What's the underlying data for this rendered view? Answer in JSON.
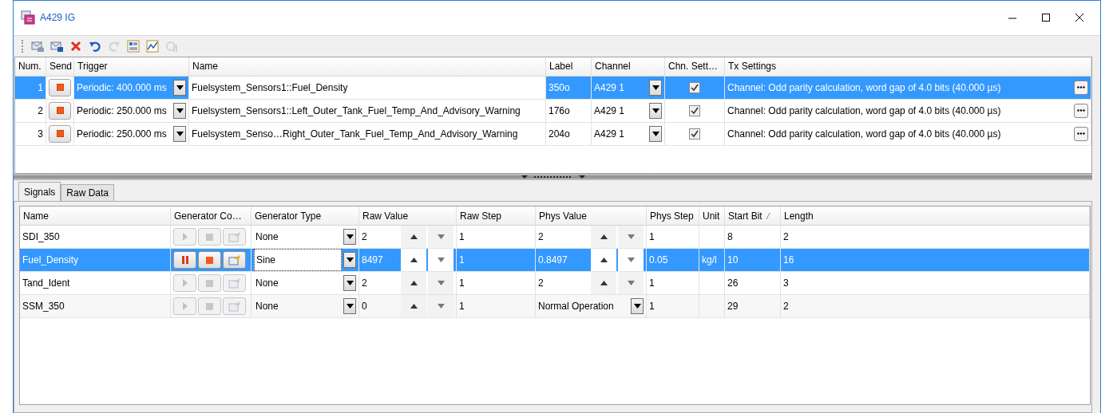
{
  "window": {
    "title": "A429 IG"
  },
  "toolbar": [
    {
      "kind": "new",
      "disabled": false
    },
    {
      "kind": "import",
      "disabled": false
    },
    {
      "kind": "delete",
      "disabled": false
    },
    {
      "kind": "undo",
      "disabled": false
    },
    {
      "kind": "redo",
      "disabled": true
    },
    {
      "kind": "layout",
      "disabled": false
    },
    {
      "kind": "chart",
      "disabled": false
    },
    {
      "kind": "sync",
      "disabled": true
    }
  ],
  "messages": {
    "columns": [
      "Num.",
      "Send",
      "Trigger",
      "Name",
      "Label",
      "Channel",
      "Chn. Sett…",
      "Tx Settings"
    ],
    "rows": [
      {
        "num": "1",
        "trigger": "Periodic: 400.000 ms",
        "name": "Fuelsystem_Sensors1::Fuel_Density",
        "label": "350o",
        "channel": "A429 1",
        "channel_settings": true,
        "tx_settings": "Channel: Odd parity calculation, word gap of 4.0 bits (40.000 µs)",
        "selected": true
      },
      {
        "num": "2",
        "trigger": "Periodic: 250.000 ms",
        "name": "Fuelsystem_Sensors1::Left_Outer_Tank_Fuel_Temp_And_Advisory_Warning",
        "label": "176o",
        "channel": "A429 1",
        "channel_settings": true,
        "tx_settings": "Channel: Odd parity calculation, word gap of 4.0 bits (40.000 µs)",
        "selected": false
      },
      {
        "num": "3",
        "trigger": "Periodic: 250.000 ms",
        "name": "Fuelsystem_Senso…Right_Outer_Tank_Fuel_Temp_And_Advisory_Warning",
        "label": "204o",
        "channel": "A429 1",
        "channel_settings": true,
        "tx_settings": "Channel: Odd parity calculation, word gap of 4.0 bits (40.000 µs)",
        "selected": false
      }
    ]
  },
  "tabs": [
    {
      "label": "Signals",
      "selected": true
    },
    {
      "label": "Raw Data",
      "selected": false
    }
  ],
  "signals": {
    "columns": [
      {
        "label": "Name",
        "sorted": false
      },
      {
        "label": "Generator Co…",
        "sorted": false
      },
      {
        "label": "Generator Type",
        "sorted": false
      },
      {
        "label": "Raw Value",
        "sorted": false
      },
      {
        "label": "Raw Step",
        "sorted": false
      },
      {
        "label": "Phys Value",
        "sorted": false
      },
      {
        "label": "Phys Step",
        "sorted": false
      },
      {
        "label": "Unit",
        "sorted": false
      },
      {
        "label": "Start Bit",
        "sorted": true
      },
      {
        "label": "Length",
        "sorted": false
      }
    ],
    "rows": [
      {
        "name": "SDI_350",
        "generator_running": false,
        "generator_type": "None",
        "raw_value": "2",
        "raw_step": "1",
        "phys_value": "2",
        "kind": "spin",
        "phys_step": "1",
        "start_bit": "8",
        "length": "2",
        "selected": false
      },
      {
        "name": "Fuel_Density",
        "generator_running": true,
        "generator_type": "Sine",
        "raw_value": "8497",
        "raw_step": "1",
        "phys_value": "0.8497",
        "kind": "spin",
        "phys_step": "0.05",
        "unit": "kg/l",
        "start_bit": "10",
        "length": "16",
        "selected": true
      },
      {
        "name": "Tand_Ident",
        "generator_running": false,
        "generator_type": "None",
        "raw_value": "2",
        "raw_step": "1",
        "phys_value": "2",
        "kind": "spin",
        "phys_step": "1",
        "start_bit": "26",
        "length": "3",
        "selected": false
      },
      {
        "name": "SSM_350",
        "generator_running": false,
        "generator_type": "None",
        "raw_value": "0",
        "raw_step": "1",
        "phys_value": "Normal Operation",
        "kind": "dropdown",
        "phys_step": "1",
        "start_bit": "29",
        "length": "2",
        "selected": false
      }
    ]
  }
}
